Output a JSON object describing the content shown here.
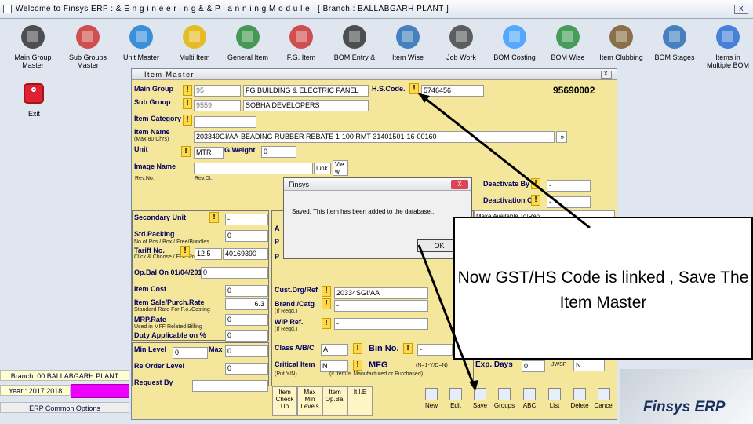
{
  "app": {
    "title": "Welcome to Finsys ERP : & E n g i n e e r i n g  & &  P l a n n i n g  M o d u l e",
    "branch_title": "[ Branch : BALLABGARH PLANT ]",
    "close": "X"
  },
  "toolbar": [
    {
      "label": "Main Group\nMaster",
      "icon": "speaker-icon"
    },
    {
      "label": "Sub Groups\nMaster",
      "icon": "robot-icon"
    },
    {
      "label": "Unit Master",
      "icon": "ie-icon"
    },
    {
      "label": "Multi Item",
      "icon": "mail-icon"
    },
    {
      "label": "General Item",
      "icon": "books-icon"
    },
    {
      "label": "F.G. Item",
      "icon": "robot-icon"
    },
    {
      "label": "BOM Entry &",
      "icon": "speaker-icon"
    },
    {
      "label": "Item Wise",
      "icon": "checklist-icon"
    },
    {
      "label": "Job Work",
      "icon": "film-icon"
    },
    {
      "label": "BOM Costing",
      "icon": "msn-icon"
    },
    {
      "label": "BOM Wise",
      "icon": "globe-icon"
    },
    {
      "label": "Item Clubbing",
      "icon": "users-icon"
    },
    {
      "label": "BOM Stages",
      "icon": "checklist-icon"
    },
    {
      "label": "Items in\nMultiple BOM",
      "icon": "monitor-icon"
    }
  ],
  "sidebar": {
    "exit": "Exit",
    "branch": "Branch: 00 BALLABGARH PLANT",
    "year": "Year : 2017 2018",
    "options": "ERP Common Options"
  },
  "item_master": {
    "title": "Item Master",
    "close": "X",
    "main_group_label": "Main Group",
    "main_group_code": "95",
    "main_group_name": "FG BUILDING & ELECTRIC PANEL",
    "hs_code_label": "H.S.Code.",
    "hs_code": "5746456",
    "item_code": "95690002",
    "sub_group_label": "Sub Group",
    "sub_group_code": "9559",
    "sub_group_name": "SOBHA DEVELOPERS",
    "item_category_label": "Item Category",
    "item_category": "-",
    "item_name_label": "Item Name",
    "item_name_sub": "(Max 80 Chrs)",
    "item_name": "203349GI/AA-BEADING RUBBER REBATE 1-100 RMT-31401501-16-00160",
    "unit_label": "Unit",
    "unit": "MTR",
    "gweight_label": "G.Weight",
    "gweight": "0",
    "image_label": "Image Name",
    "link_btn": "Link",
    "view_btn": "Vie w",
    "revno_label": "Rev.No.",
    "revdt_label": "Rev.Dt.",
    "deactivate_label": "Deactivate By",
    "deactivate": "-",
    "deactivation_label": "Deactivation On",
    "deactivation": "-",
    "make_available": "Make Available To/Rep",
    "secondary_unit_label": "Secondary Unit",
    "secondary_unit": "-",
    "std_packing_label": "Std.Packing",
    "std_packing_sub": "No of Pcs / Box / Free/Bundles",
    "std_packing": "0",
    "tariff_label": "Tariff No.",
    "tariff_sub": "Click & Choose / Else Press Esc",
    "tariff_rate": "12.5",
    "tariff_no": "40169390",
    "opbal_label": "Op.Bal On 01/04/2017",
    "opbal": "0",
    "item_cost_label": "Item Cost",
    "item_cost": "0",
    "sale_label": "Item Sale/Purch.Rate",
    "sale_sub": "Standard Rate For P.o./Costing",
    "sale": "6.3",
    "mrp_label": "MRP.Rate",
    "mrp_sub": "Used in MFF Related Billing",
    "mrp": "0",
    "duty_label": "Duty Applicable on %",
    "duty": "0",
    "minlevel_label": "Min Level",
    "minlevel": "0",
    "max_label": "Max",
    "max": "0",
    "reorder_label": "Re Order Level",
    "reorder": "0",
    "request_label": "Request By",
    "request": "-",
    "cust_drg_label": "Cust.Drg/Ref",
    "cust_drg": "20334SGI/AA",
    "brand_label": "Brand /Catg",
    "brand_sub": "(If Reqd.)",
    "brand": "-",
    "wip_label": "WIP Ref.",
    "wip_sub": "(If Reqd.)",
    "wip": "-",
    "class_label": "Class A/B/C",
    "class": "A",
    "binno_label": "Bin No.",
    "binno": "-",
    "critical_label": "Critical Item",
    "critical": "N",
    "mfg_label": "MFG",
    "mfg": "N",
    "mfg_sub": "(if Item is Manufactured or Purchased)",
    "mfg_hint": "(Put Y/N)",
    "mfg_yn": "(N=1-Y/D=N)",
    "expdays_label": "Exp. Days",
    "expdays": "0",
    "jwsf_label": "JWSF",
    "jwsf": "N",
    "partial_a": "A",
    "partial_p1": "P",
    "partial_p2": "P"
  },
  "dialog": {
    "title": "Finsys",
    "message": "Saved.  This Item has been added to the database...",
    "ok": "OK",
    "close": "X"
  },
  "bottom_left": [
    {
      "label": "Item\nCheck\nUp"
    },
    {
      "label": "Max\nMin\nLevels"
    },
    {
      "label": "Item\nOp.Bal"
    },
    {
      "label": "It.I.E"
    }
  ],
  "bottom_buttons": [
    {
      "label": "New"
    },
    {
      "label": "Edit"
    },
    {
      "label": "Save"
    },
    {
      "label": "Groups"
    },
    {
      "label": "ABC"
    },
    {
      "label": "List"
    },
    {
      "label": "Delete"
    },
    {
      "label": "Cancel"
    }
  ],
  "callout": "Now GST/HS Code is linked , Save The Item Master",
  "brand_logo": "Finsys ERP"
}
